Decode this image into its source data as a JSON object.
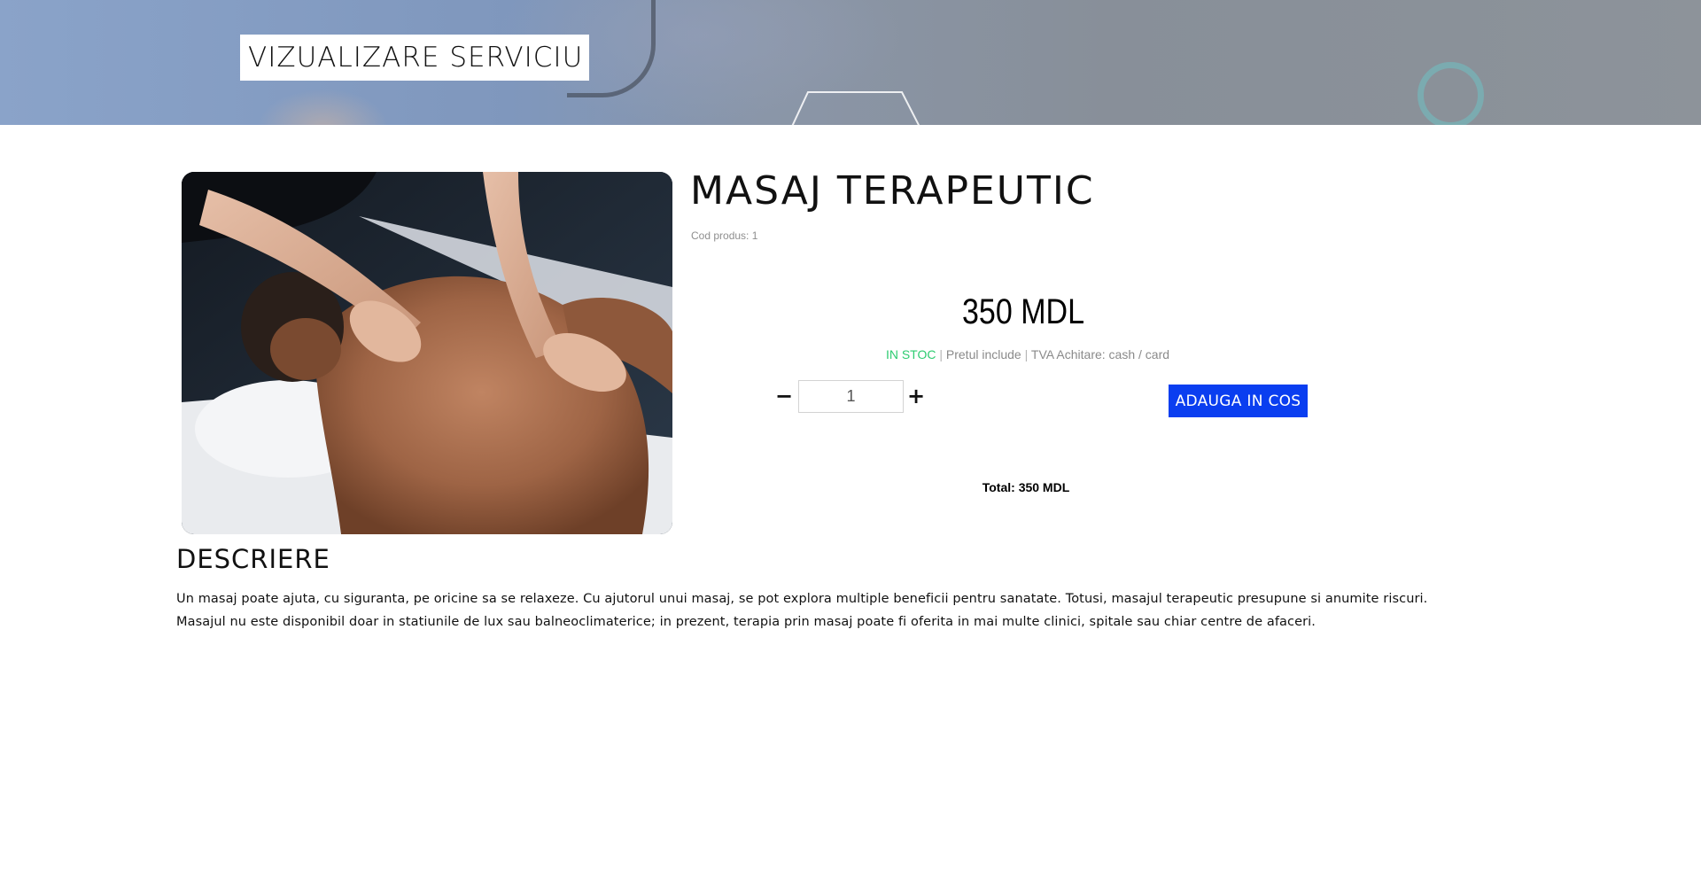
{
  "hero": {
    "title": "VIZUALIZARE SERVICIU"
  },
  "product": {
    "title": "MASAJ TERAPEUTIC",
    "code_label": "Cod produs:",
    "code_value": "1",
    "image_alt": "Masaj terapeutic",
    "price": "350 MDL",
    "stock_status": "IN STOC",
    "stock_separator": "|",
    "vat_text": "Pretul include",
    "vat_separator": "|",
    "payment_text": "TVA Achitare: cash / card",
    "quantity": "1",
    "qty_minus": "−",
    "qty_plus": "+",
    "add_to_cart_label": "ADAUGA IN COS",
    "total_label": "Total:",
    "total_value": "350 MDL"
  },
  "description": {
    "heading": "DESCRIERE",
    "lines": [
      "Un masaj poate ajuta, cu siguranta, pe oricine sa se relaxeze. Cu ajutorul unui masaj, se pot explora multiple beneficii pentru sanatate. Totusi, masajul terapeutic presupune si anumite riscuri.",
      "Masajul nu este disponibil doar in statiunile de lux sau balneoclimaterice; in prezent, terapia prin masaj poate fi oferita in mai multe clinici, spitale sau chiar centre de afaceri."
    ]
  },
  "colors": {
    "accent_button": "#0a3ef0",
    "in_stock": "#2ecc71",
    "muted_text": "#8a8a8a"
  }
}
